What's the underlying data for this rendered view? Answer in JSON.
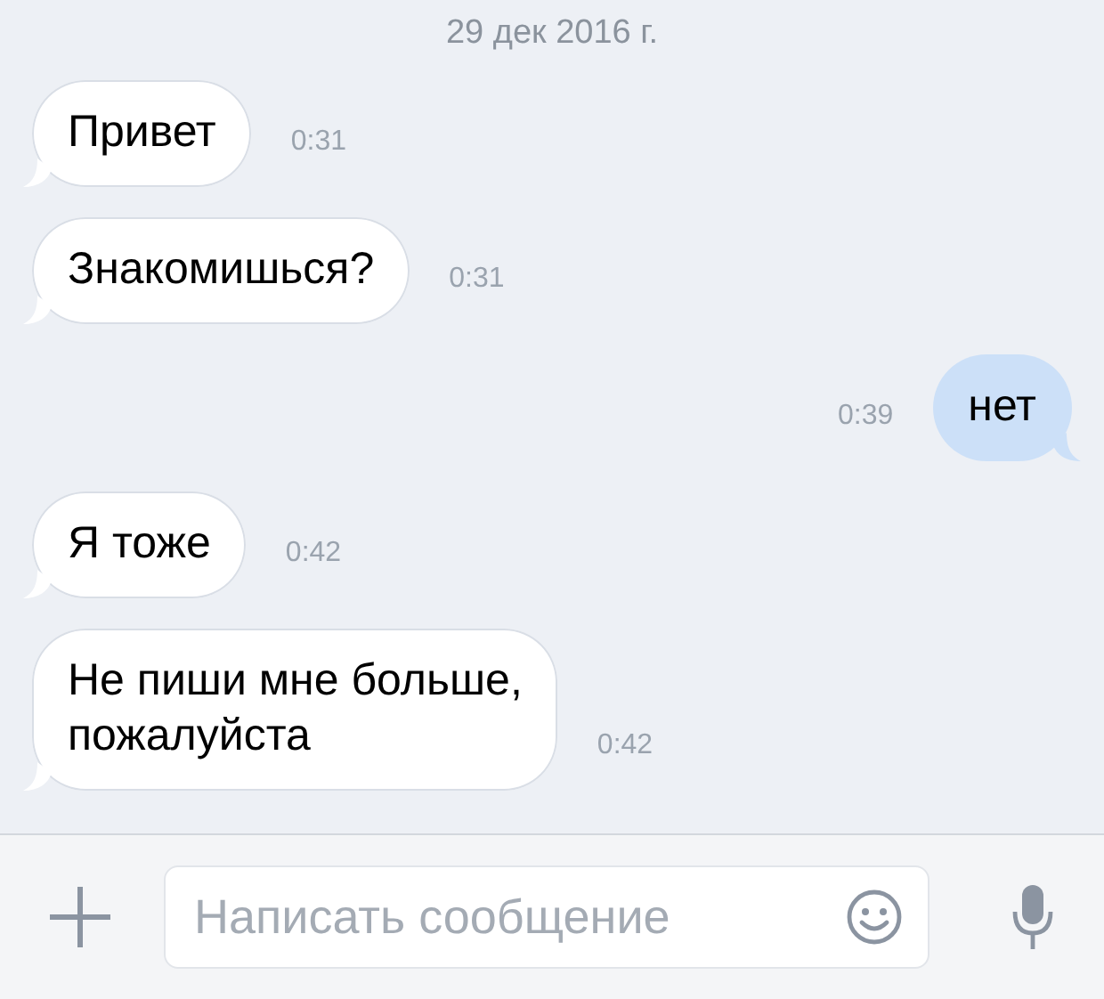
{
  "date": "29 дек 2016 г.",
  "messages": [
    {
      "kind": "incoming",
      "text": "Привет",
      "time": "0:31"
    },
    {
      "kind": "incoming",
      "text": "Знакомишься?",
      "time": "0:31"
    },
    {
      "kind": "outgoing",
      "text": "нет",
      "time": "0:39"
    },
    {
      "kind": "incoming",
      "text": "Я тоже",
      "time": "0:42"
    },
    {
      "kind": "incoming",
      "text": "Не пиши мне больше,\nпожалуйста",
      "time": "0:42"
    }
  ],
  "composer": {
    "placeholder": "Написать сообщение"
  }
}
